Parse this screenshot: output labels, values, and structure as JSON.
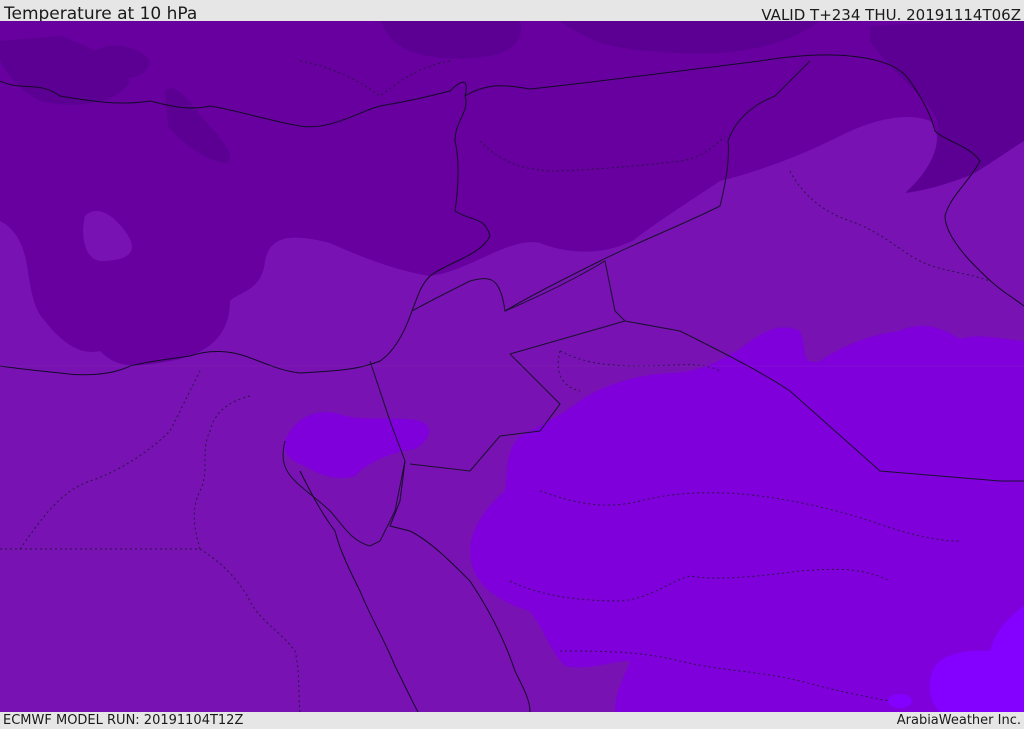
{
  "header": {
    "title": "Temperature at 10 hPa",
    "valid": "VALID T+234 THU. 20191114T06Z"
  },
  "footer": {
    "model_run": "ECMWF MODEL RUN: 20191104T12Z",
    "credit": "ArabiaWeather Inc."
  },
  "palette": {
    "darkest": "#5c0094",
    "dark": "#67009f",
    "mid": "#7812b2",
    "light": "#7f00db",
    "lightest": "#8400ff"
  }
}
